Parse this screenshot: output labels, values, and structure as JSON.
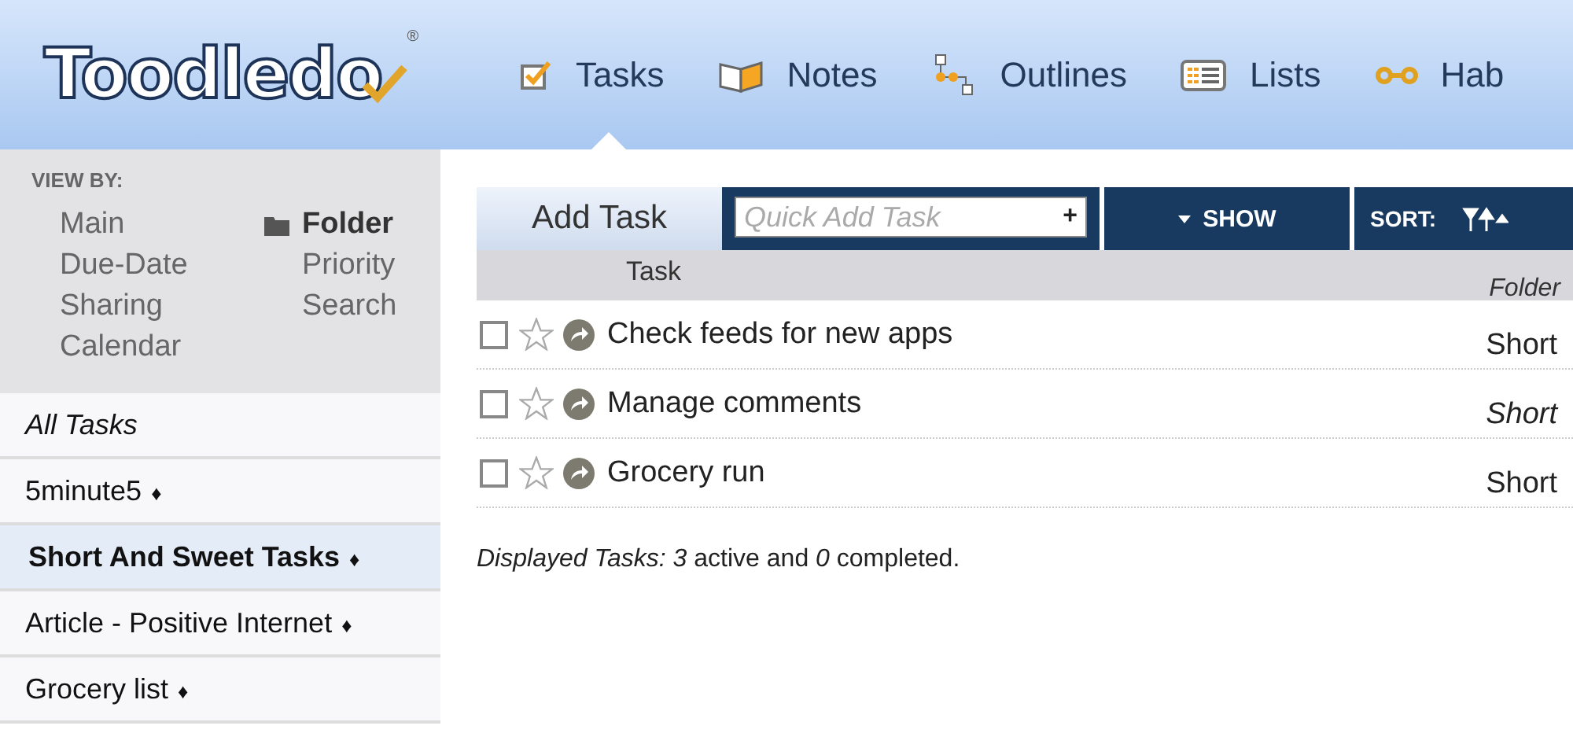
{
  "logo": {
    "text": "Toodledo",
    "mark": "®"
  },
  "nav": [
    {
      "label": "Tasks",
      "kind": "tasks",
      "selected": true
    },
    {
      "label": "Notes",
      "kind": "notes",
      "selected": false
    },
    {
      "label": "Outlines",
      "kind": "outlines",
      "selected": false
    },
    {
      "label": "Lists",
      "kind": "lists",
      "selected": false
    },
    {
      "label": "Hab",
      "kind": "habits",
      "selected": false
    }
  ],
  "view_by": {
    "title": "VIEW BY:",
    "columns": [
      [
        {
          "label": "Main",
          "selected": false
        },
        {
          "label": "Due-Date",
          "selected": false
        },
        {
          "label": "Sharing",
          "selected": false
        },
        {
          "label": "Calendar",
          "selected": false
        }
      ],
      [
        {
          "label": "Folder",
          "selected": true
        },
        {
          "label": "Priority",
          "selected": false
        },
        {
          "label": "Search",
          "selected": false
        }
      ]
    ]
  },
  "folders": [
    {
      "label": "All Tasks",
      "kind": "all",
      "selected": false
    },
    {
      "label": "5minute5",
      "marker": "♦",
      "kind": "folder",
      "selected": false
    },
    {
      "label": "Short And Sweet Tasks",
      "marker": "♦",
      "kind": "folder",
      "selected": true
    },
    {
      "label": "Article - Positive Internet",
      "marker": "♦",
      "kind": "folder",
      "selected": false
    },
    {
      "label": "Grocery list",
      "marker": "♦",
      "kind": "folder",
      "selected": false
    }
  ],
  "toolbar": {
    "add_button": "Add Task",
    "quick_add": {
      "placeholder": "Quick Add Task",
      "button": "+"
    },
    "show_button": "SHOW",
    "sort_label": "SORT:"
  },
  "table": {
    "columns": [
      "Task",
      "Folder"
    ],
    "rows": [
      {
        "checked": false,
        "starred": false,
        "task": "Check feeds for new apps",
        "folder": "Short",
        "italic": false
      },
      {
        "checked": false,
        "starred": false,
        "task": "Manage comments",
        "folder": "Short",
        "italic": true
      },
      {
        "checked": false,
        "starred": false,
        "task": "Grocery run",
        "folder": "Short",
        "italic": false
      }
    ]
  },
  "summary": "*Displayed Tasks: 3* active and *0* completed."
}
